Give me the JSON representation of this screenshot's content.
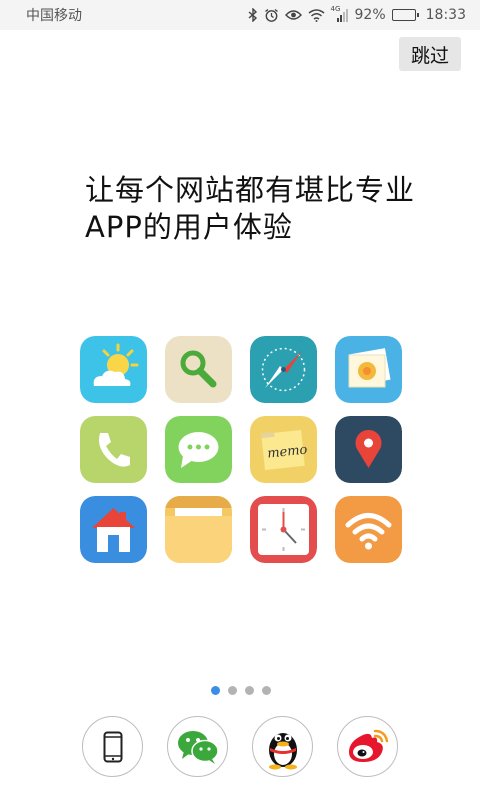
{
  "status_bar": {
    "carrier": "中国移动",
    "network": "4G",
    "battery_level": "92%",
    "battery_fraction": 0.92,
    "time": "18:33",
    "icons": [
      "bluetooth-icon",
      "alarm-icon",
      "eye-icon",
      "wifi-icon",
      "signal-icon",
      "battery-icon"
    ]
  },
  "skip_label": "跳过",
  "headline": "让每个网站都有堪比专业APP的用户体验",
  "apps": [
    {
      "icon": "weather-icon",
      "color": "#3ec3e8"
    },
    {
      "icon": "search-icon",
      "color": "#ece1c4"
    },
    {
      "icon": "compass-icon",
      "color": "#2aa0b0"
    },
    {
      "icon": "gallery-icon",
      "color": "#4bb2e6"
    },
    {
      "icon": "phone-icon",
      "color": "#b7d56a"
    },
    {
      "icon": "message-icon",
      "color": "#82d35e"
    },
    {
      "icon": "memo-icon",
      "color": "#f1d166"
    },
    {
      "icon": "location-icon",
      "color": "#2e4a62"
    },
    {
      "icon": "home-icon",
      "color": "#3a8ee0"
    },
    {
      "icon": "folder-icon",
      "color": "#f5c862"
    },
    {
      "icon": "clock-icon",
      "color": "#e44d4d"
    },
    {
      "icon": "wifi-icon",
      "color": "#f39a45"
    }
  ],
  "memo_text": "memo",
  "pager": {
    "pages": 4,
    "active": 0
  },
  "login_options": [
    "phone-icon",
    "wechat-icon",
    "qq-icon",
    "weibo-icon"
  ]
}
